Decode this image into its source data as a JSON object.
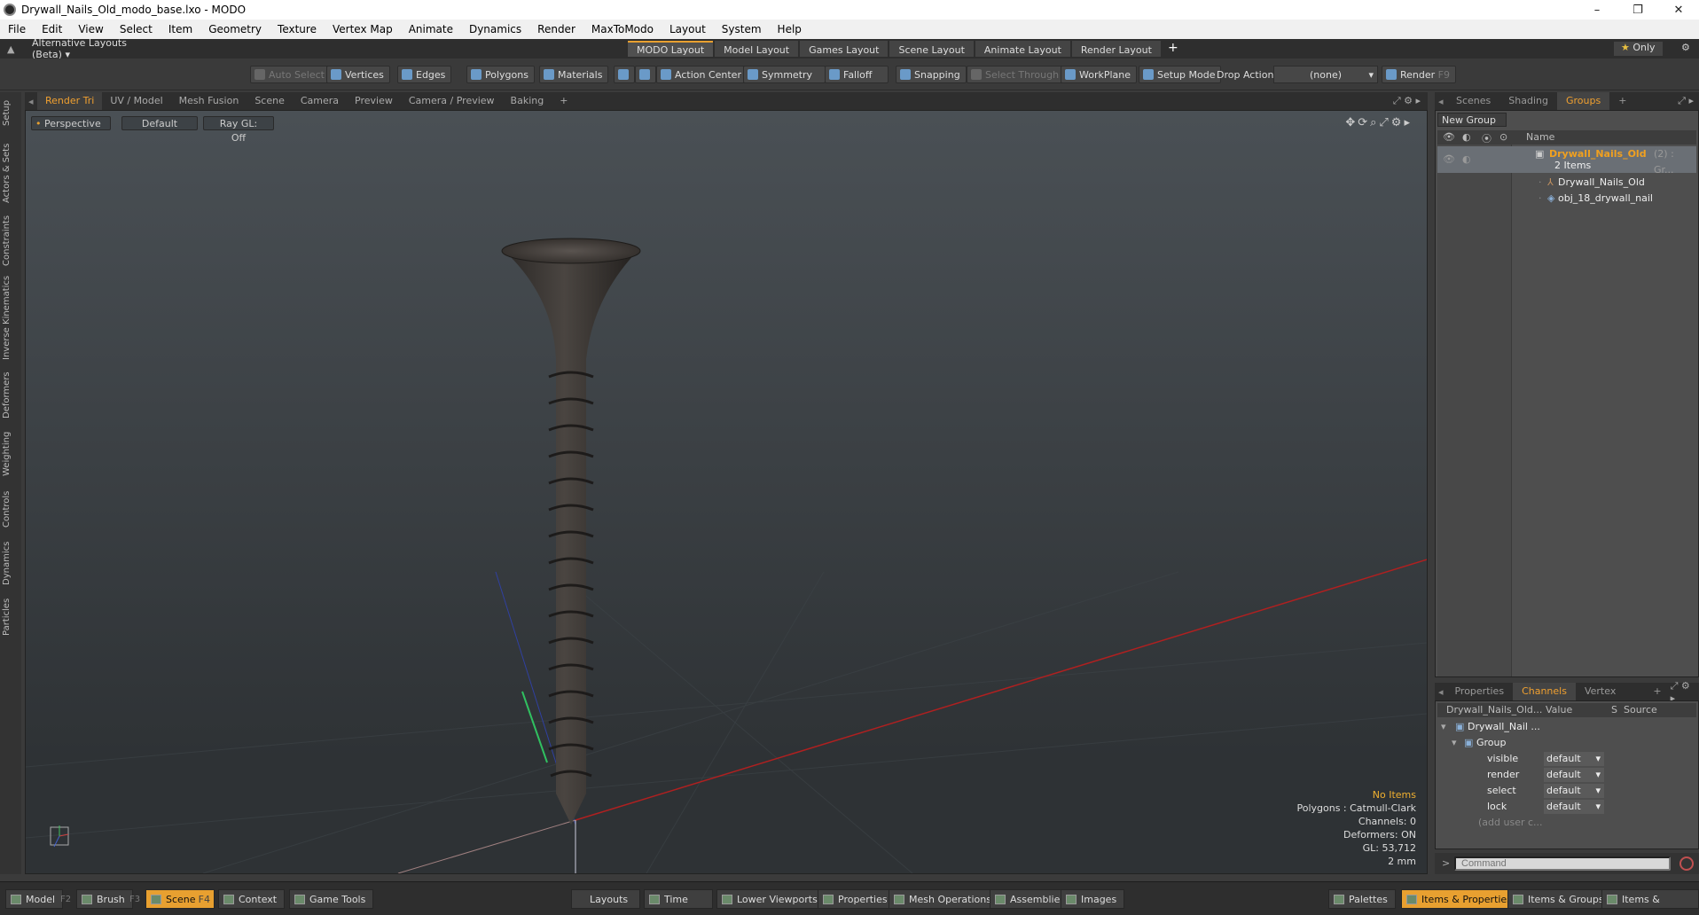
{
  "window": {
    "title": "Drywall_Nails_Old_modo_base.lxo - MODO",
    "controls": [
      "–",
      "❐",
      "✕"
    ]
  },
  "menu": [
    "File",
    "Edit",
    "View",
    "Select",
    "Item",
    "Geometry",
    "Texture",
    "Vertex Map",
    "Animate",
    "Dynamics",
    "Render",
    "MaxToModo",
    "Layout",
    "System",
    "Help"
  ],
  "layoutbar": {
    "alt_layouts": "Alternative Layouts (Beta)",
    "tabs": [
      "MODO Layout",
      "Model Layout",
      "Games Layout",
      "Scene Layout",
      "Animate Layout",
      "Render Layout"
    ],
    "add": "+",
    "only": "Only"
  },
  "toolbar": {
    "auto_select": "Auto Select",
    "vertices": "Vertices",
    "edges": "Edges",
    "polygons": "Polygons",
    "materials": "Materials",
    "action_center": "Action Center",
    "symmetry": "Symmetry",
    "falloff": "Falloff",
    "snapping": "Snapping",
    "select_through": "Select Through",
    "workplane": "WorkPlane",
    "setup_mode": "Setup Mode",
    "drop_action": "Drop Action",
    "drop_value": "(none)",
    "render": "Render",
    "render_key": "F9"
  },
  "left_tabs": [
    "Setup",
    "Actors & Sets",
    "Constraints",
    "Inverse Kinematics",
    "Deformers",
    "Weighting",
    "Controls",
    "Dynamics",
    "Particles"
  ],
  "viewport_tabs": [
    "Render Tri",
    "UV / Model",
    "Mesh Fusion",
    "Scene",
    "Camera",
    "Preview",
    "Camera / Preview",
    "Baking",
    "+"
  ],
  "viewport": {
    "view": "Perspective",
    "shading": "Default",
    "raygl": "Ray GL: Off"
  },
  "stats": {
    "items": "No Items",
    "polygons": "Polygons : Catmull-Clark",
    "channels": "Channels: 0",
    "deformers": "Deformers: ON",
    "gl": "GL: 53,712",
    "scale": "2 mm"
  },
  "right_tabs": [
    "Scenes",
    "Shading",
    "Groups",
    "+"
  ],
  "groups": {
    "new_group": "New Group",
    "name_header": "Name",
    "group_name": "Drywall_Nails_Old",
    "group_suffix": "(2) : Gr...",
    "count": "2 Items",
    "children": [
      "Drywall_Nails_Old",
      "obj_18_drywall_nail"
    ]
  },
  "channel_tabs": [
    "Properties",
    "Channels",
    "Vertex Maps",
    "+"
  ],
  "channels": {
    "col_name": "Drywall_Nails_Old...",
    "col_value": "Value",
    "col_s": "S",
    "col_source": "Source",
    "item": "Drywall_Nail ...",
    "group": "Group",
    "rows": [
      {
        "name": "visible",
        "value": "default"
      },
      {
        "name": "render",
        "value": "default"
      },
      {
        "name": "select",
        "value": "default"
      },
      {
        "name": "lock",
        "value": "default"
      }
    ],
    "add_user": "(add user c..."
  },
  "command": {
    "placeholder": "Command",
    "prompt": ">"
  },
  "bottom": {
    "model": "Model",
    "f2": "F2",
    "brush": "Brush",
    "f3": "F3",
    "scene": "Scene",
    "f4": "F4",
    "context": "Context",
    "game_tools": "Game Tools",
    "layouts": "Layouts",
    "time": "Time",
    "lower_viewports": "Lower Viewports",
    "properties": "Properties",
    "mesh_operations": "Mesh Operations",
    "assemblies": "Assemblies",
    "images": "Images",
    "palettes": "Palettes",
    "items_properties": "Items & Properties",
    "items_groups": "Items & Groups",
    "items_shading": "Items & Shading"
  }
}
